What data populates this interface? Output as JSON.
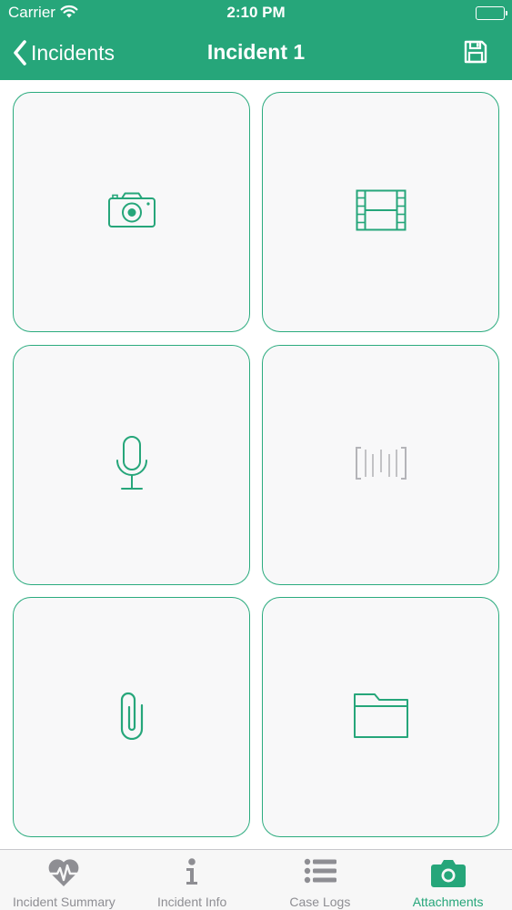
{
  "status_bar": {
    "carrier": "Carrier",
    "time": "2:10 PM",
    "wifi_icon": "wifi-icon",
    "battery_icon": "battery-full-icon",
    "battery_level": 1.0
  },
  "nav": {
    "back_label": "Incidents",
    "title": "Incident 1",
    "back_icon": "chevron-left-icon",
    "save_icon": "floppy-disk-icon"
  },
  "tiles": [
    {
      "icon": "camera-icon",
      "enabled": true
    },
    {
      "icon": "film-strip-icon",
      "enabled": true
    },
    {
      "icon": "microphone-icon",
      "enabled": true
    },
    {
      "icon": "barcode-scanner-icon",
      "enabled": false
    },
    {
      "icon": "paperclip-icon",
      "enabled": true
    },
    {
      "icon": "folder-icon",
      "enabled": true
    }
  ],
  "tab_bar": {
    "tabs": [
      {
        "label": "Incident Summary",
        "icon": "heart-pulse-icon",
        "active": false
      },
      {
        "label": "Incident Info",
        "icon": "info-icon",
        "active": false
      },
      {
        "label": "Case Logs",
        "icon": "list-icon",
        "active": false
      },
      {
        "label": "Attachments",
        "icon": "camera-icon",
        "active": true
      }
    ]
  },
  "colors": {
    "brand": "#26a67a",
    "tile_border": "#2bab7e",
    "tile_background": "#f8f8f9",
    "disabled_icon": "#b4b4b8",
    "tab_inactive": "#8e8e93"
  }
}
